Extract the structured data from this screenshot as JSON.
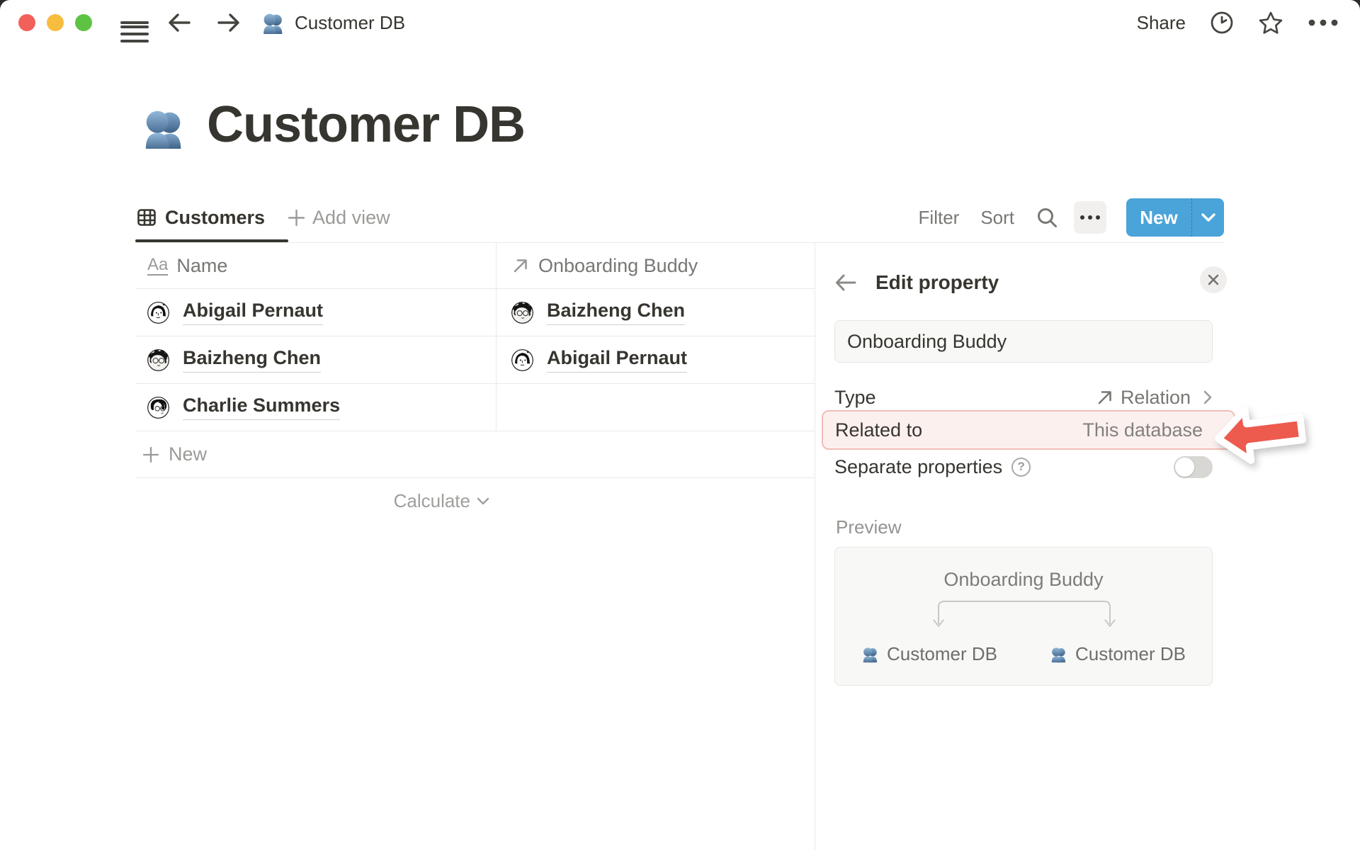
{
  "window": {
    "breadcrumb_title": "Customer DB",
    "share_label": "Share"
  },
  "page": {
    "title": "Customer DB"
  },
  "toolbar": {
    "view_tab_label": "Customers",
    "add_view_label": "Add view",
    "filter_label": "Filter",
    "sort_label": "Sort",
    "new_button_label": "New"
  },
  "table": {
    "columns": [
      {
        "label": "Name",
        "type_icon": "text-type-icon"
      },
      {
        "label": "Onboarding Buddy",
        "type_icon": "relation-arrow-icon"
      }
    ],
    "rows": [
      {
        "name": "Abigail Pernaut",
        "buddy": "Baizheng Chen"
      },
      {
        "name": "Baizheng Chen",
        "buddy": "Abigail Pernaut"
      },
      {
        "name": "Charlie Summers",
        "buddy": ""
      }
    ],
    "new_row_label": "New",
    "calculate_label": "Calculate"
  },
  "panel": {
    "title": "Edit property",
    "property_name_value": "Onboarding Buddy",
    "type_label": "Type",
    "type_value": "Relation",
    "related_label": "Related to",
    "related_value": "This database",
    "separate_label": "Separate properties",
    "separate_help_glyph": "?",
    "preview_label": "Preview",
    "preview": {
      "diagram_title": "Onboarding Buddy",
      "left_db_label": "Customer DB",
      "right_db_label": "Customer DB"
    }
  },
  "colors": {
    "accent_blue_button": "#4aa3d9",
    "highlight_pink_bg": "#fcf0ef",
    "highlight_pink_border": "#f3bcb6",
    "annotation_red": "#ed5a4e",
    "text_dark": "#37352f",
    "text_gray": "#787774",
    "divider": "#e9e9e7",
    "people_icon_blue": "#5b84aa",
    "traffic_red": "#f2605a",
    "traffic_yellow": "#f6bd3e",
    "traffic_green": "#5ec344"
  }
}
